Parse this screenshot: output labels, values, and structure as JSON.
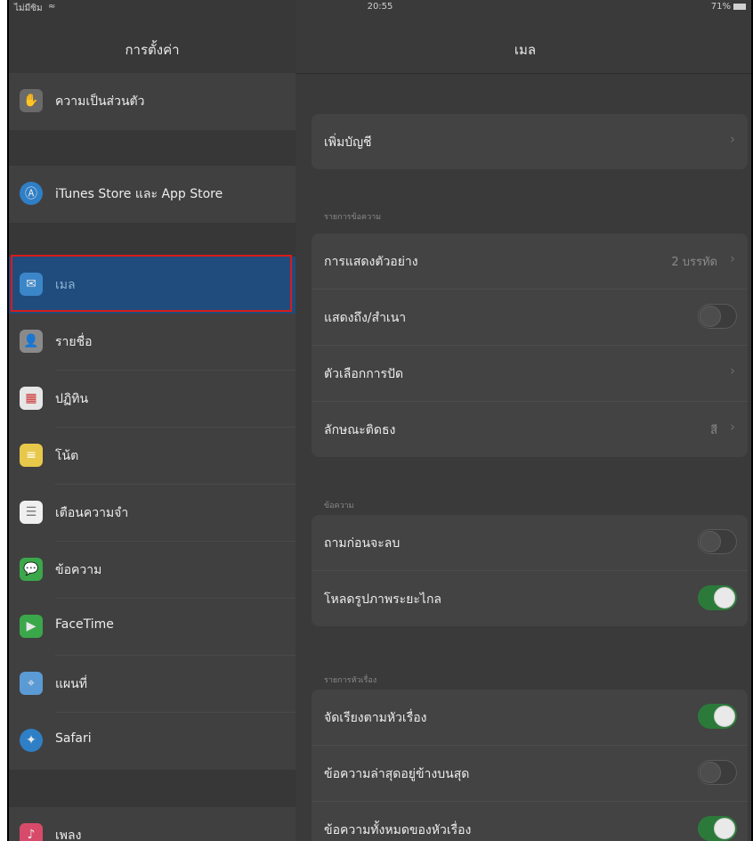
{
  "status": {
    "carrier": "ไม่มีซิม",
    "time": "20:55",
    "battery": "71%"
  },
  "left": {
    "title": "การตั้งค่า",
    "items": [
      {
        "label": "ความเป็นส่วนตัว",
        "icon": "privacy-hand-icon",
        "color": "#6a6a6a"
      },
      {
        "label": "iTunes Store และ App Store",
        "icon": "app-store-icon",
        "color": "#2f7fc6"
      },
      {
        "label": "เมล",
        "icon": "mail-icon",
        "color": "#3b86c9"
      },
      {
        "label": "รายชื่อ",
        "icon": "contacts-icon",
        "color": "#8a8a8a"
      },
      {
        "label": "ปฏิทิน",
        "icon": "calendar-icon",
        "color": "#e6e6e6"
      },
      {
        "label": "โน้ต",
        "icon": "notes-icon",
        "color": "#e8c84a"
      },
      {
        "label": "เตือนความจำ",
        "icon": "reminders-icon",
        "color": "#efefef"
      },
      {
        "label": "ข้อความ",
        "icon": "messages-icon",
        "color": "#3aa84a"
      },
      {
        "label": "FaceTime",
        "icon": "facetime-icon",
        "color": "#3aa84a"
      },
      {
        "label": "แผนที่",
        "icon": "maps-icon",
        "color": "#5b9bd5"
      },
      {
        "label": "Safari",
        "icon": "safari-icon",
        "color": "#2f7fc6"
      },
      {
        "label": "เพลง",
        "icon": "music-icon",
        "color": "#d84a6a"
      }
    ]
  },
  "right": {
    "title": "เมล",
    "add_account": "เพิ่มบัญชี",
    "sections": {
      "message_list": "รายการข้อความ",
      "messages": "ข้อความ",
      "threading": "รายการหัวเรื่อง"
    },
    "list": [
      {
        "label": "การแสดงตัวอย่าง",
        "value": "2 บรรทัด"
      },
      {
        "label": "แสดงถึง/สำเนา",
        "toggle": false
      },
      {
        "label": "ตัวเลือกการปัด"
      },
      {
        "label": "ลักษณะติดธง",
        "value": "สี"
      }
    ],
    "messages": [
      {
        "label": "ถามก่อนจะลบ",
        "toggle": false
      },
      {
        "label": "โหลดรูปภาพระยะไกล",
        "toggle": true
      }
    ],
    "threading": [
      {
        "label": "จัดเรียงตามหัวเรื่อง",
        "toggle": true
      },
      {
        "label": "ข้อความล่าสุดอยู่ข้างบนสุด",
        "toggle": false
      },
      {
        "label": "ข้อความทั้งหมดของหัวเรื่อง",
        "toggle": true
      }
    ]
  }
}
